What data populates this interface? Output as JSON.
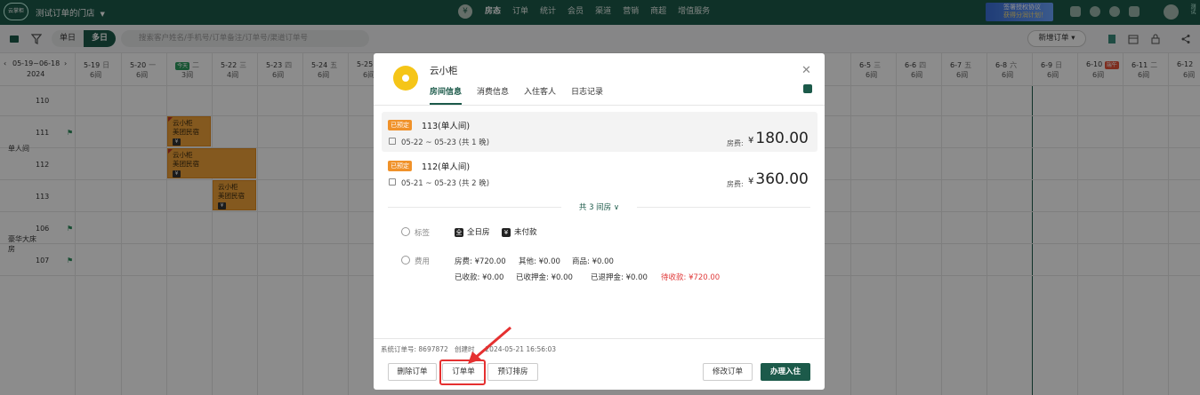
{
  "topbar": {
    "logo_label": "云掌柜",
    "store_name": "测试订单的门店",
    "nav_items": [
      "房态",
      "订单",
      "统计",
      "会员",
      "渠道",
      "营销",
      "商超",
      "增值服务"
    ],
    "active_nav": "房态",
    "banner_line1": "签署授权协议",
    "banner_line2": "获得分润计划！",
    "user_label": "测试"
  },
  "toolbar": {
    "view_single": "单日",
    "view_multi": "多日",
    "search_placeholder": "搜索客户姓名/手机号/订单备注/订单号/渠道订单号",
    "new_order": "新增订单"
  },
  "calendar": {
    "range_label": "05-19~06-18",
    "year": "2024",
    "days": [
      {
        "date": "5-19",
        "week": "日",
        "count": "6间"
      },
      {
        "date": "5-20",
        "week": "一",
        "count": "6间"
      },
      {
        "date": "",
        "week": "二",
        "count": "3间",
        "badge": "今天",
        "badge_color": "#2e9b5f"
      },
      {
        "date": "5-22",
        "week": "三",
        "count": "4间"
      },
      {
        "date": "5-23",
        "week": "四",
        "count": "6间"
      },
      {
        "date": "5-24",
        "week": "五",
        "count": "6间"
      },
      {
        "date": "5-25",
        "week": "",
        "count": "6间"
      },
      {
        "date": "6-5",
        "week": "三",
        "count": "6间"
      },
      {
        "date": "6-6",
        "week": "四",
        "count": "6间"
      },
      {
        "date": "6-7",
        "week": "五",
        "count": "6间"
      },
      {
        "date": "6-8",
        "week": "六",
        "count": "6间"
      },
      {
        "date": "6-9",
        "week": "日",
        "count": "6间"
      },
      {
        "date": "6-10",
        "week": "",
        "count": "6间",
        "badge": "端午",
        "badge_color": "#e5533a"
      },
      {
        "date": "6-11",
        "week": "二",
        "count": "6间"
      },
      {
        "date": "6-12",
        "week": "",
        "count": "6间"
      }
    ],
    "room_types": [
      "单人间",
      "豪华大床房"
    ],
    "rooms": [
      "110",
      "111",
      "112",
      "113",
      "106",
      "107"
    ],
    "bookings": [
      {
        "name": "云小柜",
        "source": "美团民宿",
        "paid": "¥"
      },
      {
        "name": "云小柜",
        "source": "美团民宿",
        "paid": "¥"
      },
      {
        "name": "云小柜",
        "source": "美团民宿",
        "paid": "¥"
      }
    ]
  },
  "modal": {
    "guest_name": "云小柜",
    "tabs": [
      "房间信息",
      "消费信息",
      "入住客人",
      "日志记录"
    ],
    "active_tab": "房间信息",
    "rooms": [
      {
        "status": "已预定",
        "name": "113(单人间)",
        "dates": "05-22 ~ 05-23 (共 1 晚)",
        "fee_label": "房费:",
        "currency": "¥",
        "price": "180.00"
      },
      {
        "status": "已预定",
        "name": "112(单人间)",
        "dates": "05-21 ~ 05-23 (共 2 晚)",
        "fee_label": "房费:",
        "currency": "¥",
        "price": "360.00"
      }
    ],
    "more_rooms": "共 3 间房 ∨",
    "tag_label": "标签",
    "tags": [
      {
        "icon": "全",
        "text": "全日房"
      },
      {
        "icon": "¥",
        "text": "未付款"
      }
    ],
    "fee_label": "费用",
    "fees_row1": [
      "房费: ¥720.00",
      "其他: ¥0.00",
      "商品: ¥0.00"
    ],
    "fees_row2": [
      "已收款: ¥0.00",
      "已收押金: ¥0.00",
      "已退押金: ¥0.00"
    ],
    "fees_due": "待收款: ¥720.00",
    "system_order": "系统订单号: 8697872",
    "created": "创建时",
    "created_time": "2024-05-21 16:56:03",
    "buttons": {
      "delete": "删除订单",
      "receipt": "订单单",
      "arrange": "预订排房",
      "edit": "修改订单",
      "checkin": "办理入住"
    }
  },
  "colors": {
    "brand": "#1c5a4a",
    "booking": "#f1a23a",
    "due": "#e03a3a",
    "highlight": "#e53030"
  }
}
